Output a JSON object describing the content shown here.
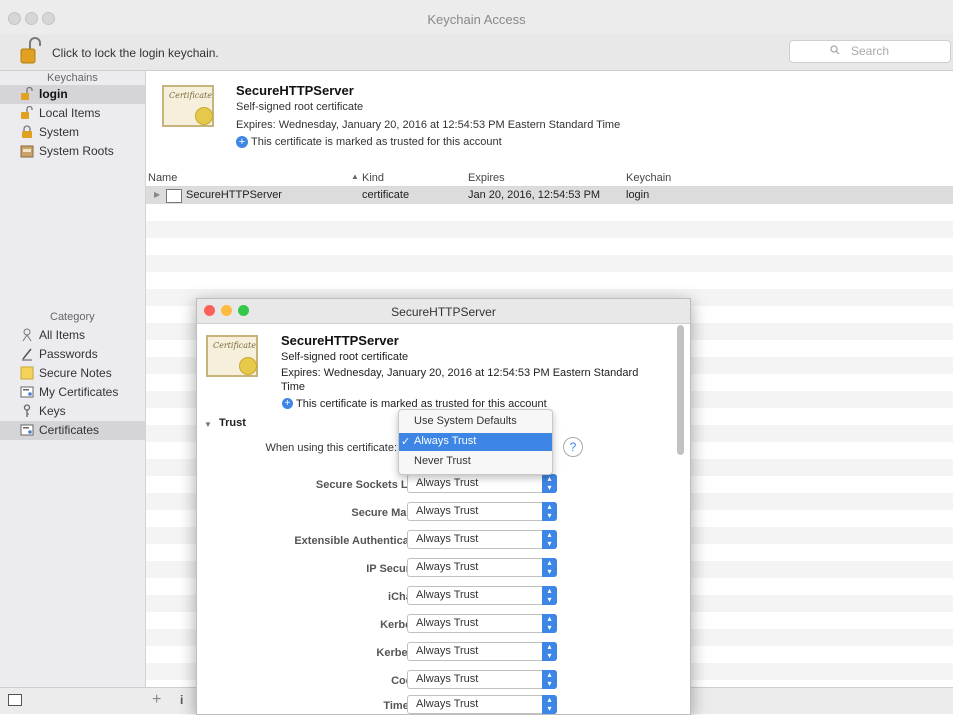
{
  "window": {
    "title": "Keychain Access",
    "lock_text": "Click to lock the login keychain.",
    "search_placeholder": "Search"
  },
  "sidebar": {
    "keychains_header": "Keychains",
    "keychains": [
      {
        "label": "login",
        "icon": "lock-open-icon"
      },
      {
        "label": "Local Items",
        "icon": "lock-open-icon"
      },
      {
        "label": "System",
        "icon": "lock-closed-icon"
      },
      {
        "label": "System Roots",
        "icon": "cabinet-icon"
      }
    ],
    "category_header": "Category",
    "categories": [
      {
        "label": "All Items",
        "icon": "all-items-icon"
      },
      {
        "label": "Passwords",
        "icon": "pen-icon"
      },
      {
        "label": "Secure Notes",
        "icon": "note-icon"
      },
      {
        "label": "My Certificates",
        "icon": "certificate-icon"
      },
      {
        "label": "Keys",
        "icon": "key-icon"
      },
      {
        "label": "Certificates",
        "icon": "certificate-icon"
      }
    ]
  },
  "cert_header": {
    "name": "SecureHTTPServer",
    "kind": "Self-signed root certificate",
    "expires": "Expires: Wednesday, January 20, 2016 at 12:54:53 PM Eastern Standard Time",
    "trust_note": "This certificate is marked as trusted for this account",
    "image_text": "Certificate"
  },
  "table": {
    "columns": [
      "Name",
      "Kind",
      "Expires",
      "Keychain"
    ],
    "rows": [
      {
        "name": "SecureHTTPServer",
        "kind": "certificate",
        "expires": "Jan 20, 2016, 12:54:53 PM",
        "keychain": "login"
      }
    ]
  },
  "sheet": {
    "title": "SecureHTTPServer",
    "name": "SecureHTTPServer",
    "kind": "Self-signed root certificate",
    "expires_line1": "Expires: Wednesday, January 20, 2016 at 12:54:53 PM Eastern Standard",
    "expires_line2": "Time",
    "trust_note": "This certificate is marked as trusted for this account",
    "trust_header": "Trust",
    "when_using_label": "When using this certificate:",
    "help": "?",
    "popup_options": [
      "Use System Defaults",
      "Always Trust",
      "Never Trust"
    ],
    "popup_selected": "Always Trust",
    "policies": [
      {
        "label": "Secure Sockets Layer (SSL)",
        "value": "Always Trust"
      },
      {
        "label": "Secure Mail (S/MIME)",
        "value": "Always Trust"
      },
      {
        "label": "Extensible Authentication (EAP)",
        "value": "Always Trust"
      },
      {
        "label": "IP Security (IPsec)",
        "value": "Always Trust"
      },
      {
        "label": "iChat Security",
        "value": "Always Trust"
      },
      {
        "label": "Kerberos Client",
        "value": "Always Trust"
      },
      {
        "label": "Kerberos Server",
        "value": "Always Trust"
      },
      {
        "label": "Code Signing",
        "value": "Always Trust"
      },
      {
        "label": "Time Stamping",
        "value": "Always Trust"
      }
    ]
  },
  "bottom": {
    "add": "+",
    "info": "i"
  },
  "colors": {
    "accent": "#3d86e6",
    "close": "#fc605b",
    "minimize": "#fdbc40",
    "zoom": "#34c84a"
  }
}
